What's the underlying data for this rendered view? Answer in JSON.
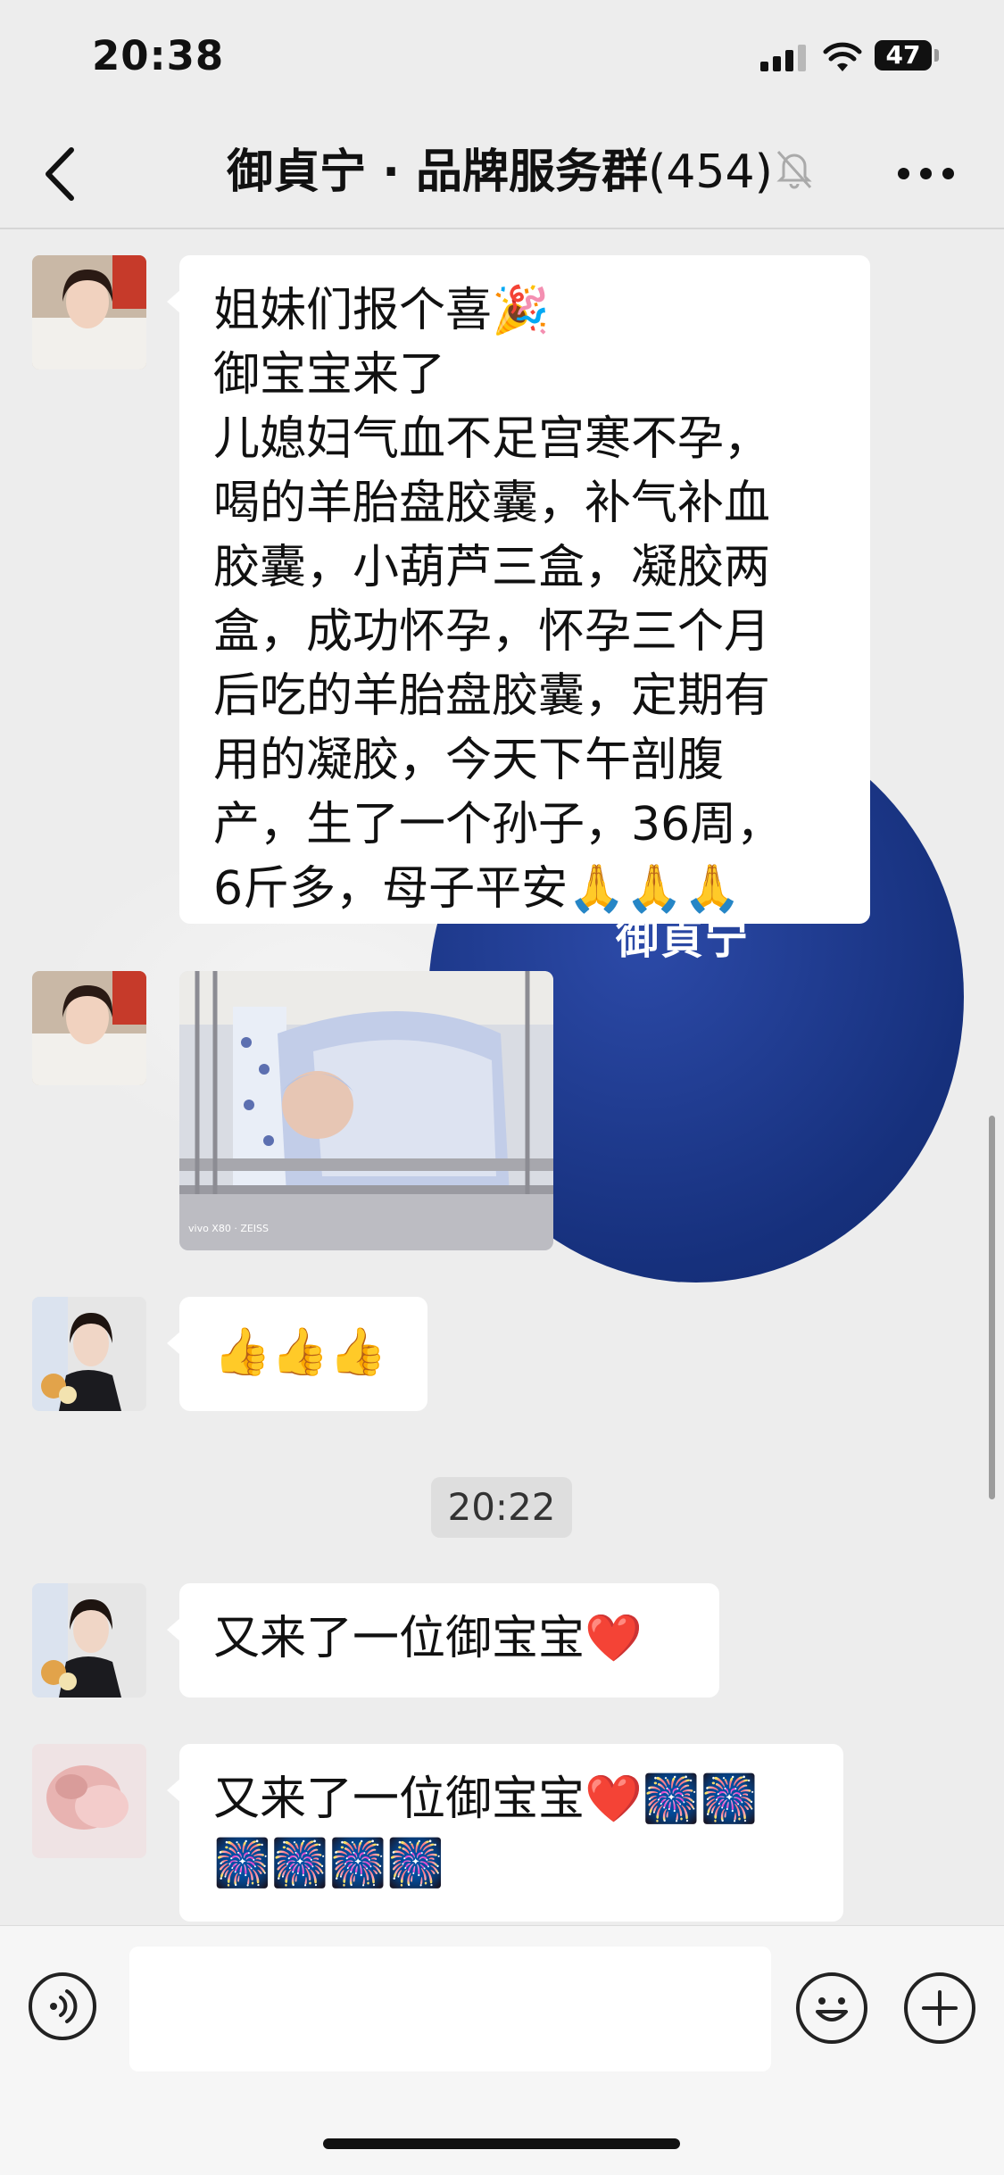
{
  "status_bar": {
    "time": "20:38",
    "battery": "47"
  },
  "nav": {
    "title": "御貞宁 · 品牌服务群",
    "member_count": "(454)"
  },
  "background": {
    "brand_text": "御貞宁"
  },
  "messages": [
    {
      "type": "text",
      "text": "姐妹们报个喜🎉\n御宝宝来了\n儿媳妇气血不足宫寒不孕，\n喝的羊胎盘胶囊，补气补血\n胶囊，小葫芦三盒，凝胶两\n盒，成功怀孕，怀孕三个月\n后吃的羊胎盘胶囊，定期有\n用的凝胶，今天下午剖腹\n产，生了一个孙子，36周，\n6斤多，母子平安🙏🙏🙏"
    },
    {
      "type": "image",
      "caption": "vivo X80 · ZEISS"
    },
    {
      "type": "text",
      "text": "👍👍👍"
    },
    {
      "type": "time",
      "text": "20:22"
    },
    {
      "type": "text",
      "text": "又来了一位御宝宝❤️"
    },
    {
      "type": "text",
      "text": "又来了一位御宝宝❤️🎆🎆\n🎆🎆🎆🎆"
    }
  ],
  "colors": {
    "bubble": "#ffffff",
    "chat_bg": "#ededed",
    "brand_blue": "#1a3a8f"
  },
  "icons": [
    "back-chevron-icon",
    "mute-bell-icon",
    "more-dots-icon",
    "voice-icon",
    "emoji-icon",
    "plus-icon"
  ]
}
